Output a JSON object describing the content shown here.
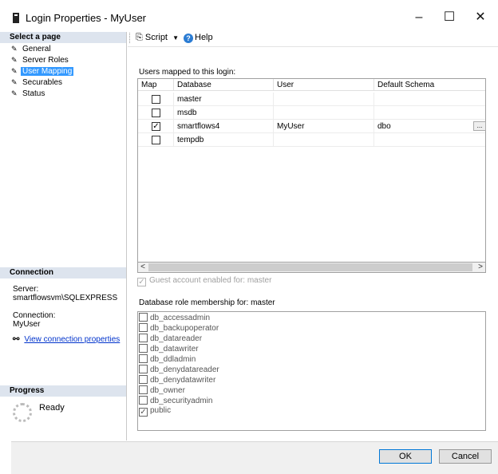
{
  "window": {
    "title": "Login Properties - MyUser",
    "minimize": "–",
    "maximize": "☐",
    "close": "✕"
  },
  "left": {
    "select_page_header": "Select a page",
    "pages": [
      {
        "label": "General",
        "selected": false
      },
      {
        "label": "Server Roles",
        "selected": false
      },
      {
        "label": "User Mapping",
        "selected": true
      },
      {
        "label": "Securables",
        "selected": false
      },
      {
        "label": "Status",
        "selected": false
      }
    ],
    "connection_header": "Connection",
    "server_label": "Server:",
    "server_value": "smartflowsvm\\SQLEXPRESS",
    "connection_label": "Connection:",
    "connection_value": "MyUser",
    "view_connection_link": "View connection properties",
    "progress_header": "Progress",
    "progress_status": "Ready"
  },
  "toolbar": {
    "script_label": "Script",
    "help_label": "Help"
  },
  "users_mapped": {
    "label": "Users mapped to this login:",
    "columns": [
      "Map",
      "Database",
      "User",
      "Default Schema"
    ],
    "rows": [
      {
        "map": false,
        "database": "master",
        "user": "",
        "schema": ""
      },
      {
        "map": false,
        "database": "msdb",
        "user": "",
        "schema": ""
      },
      {
        "map": true,
        "database": "smartflows4",
        "user": "MyUser",
        "schema": "dbo"
      },
      {
        "map": false,
        "database": "tempdb",
        "user": "",
        "schema": ""
      }
    ],
    "ellipsis": "..."
  },
  "guest": {
    "label": "Guest account enabled for: master",
    "checked": true
  },
  "roles": {
    "label": "Database role membership for: master",
    "items": [
      {
        "name": "db_accessadmin",
        "checked": false
      },
      {
        "name": "db_backupoperator",
        "checked": false
      },
      {
        "name": "db_datareader",
        "checked": false
      },
      {
        "name": "db_datawriter",
        "checked": false
      },
      {
        "name": "db_ddladmin",
        "checked": false
      },
      {
        "name": "db_denydatareader",
        "checked": false
      },
      {
        "name": "db_denydatawriter",
        "checked": false
      },
      {
        "name": "db_owner",
        "checked": false
      },
      {
        "name": "db_securityadmin",
        "checked": false
      },
      {
        "name": "public",
        "checked": true
      }
    ]
  },
  "buttons": {
    "ok": "OK",
    "cancel": "Cancel"
  },
  "check_glyph": "✓",
  "colors": {
    "selection": "#3399ff",
    "section_header": "#dde4ee",
    "link": "#0033cc"
  }
}
